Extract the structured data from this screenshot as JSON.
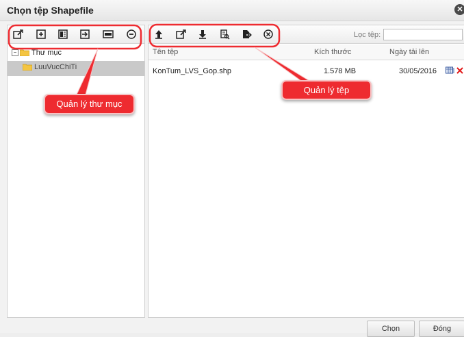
{
  "dialog": {
    "title": "Chọn tệp Shapefile"
  },
  "folder_pane": {
    "tree": {
      "root_label": "Thư mục",
      "child_label": "LuuVucChiTi"
    }
  },
  "file_pane": {
    "filter_label": "Lọc tệp:",
    "filter_value": "",
    "columns": {
      "name": "Tên tệp",
      "size": "Kích thước",
      "date": "Ngày tải lên"
    },
    "rows": [
      {
        "name": "KonTum_LVS_Gop.shp",
        "size": "1.578 MB",
        "date": "30/05/2016"
      }
    ]
  },
  "annotations": {
    "folder_management": "Quản lý thư mục",
    "file_management": "Quản lý tệp"
  },
  "footer": {
    "choose_label": "Chọn",
    "close_label": "Đóng"
  },
  "colors": {
    "callout": "#ee2b30",
    "folder": "#f4c542",
    "selected_row": "#c9c9c9"
  },
  "icons": [
    "folder-properties-icon",
    "new-folder-icon",
    "folder-list-icon",
    "move-folder-icon",
    "rename-folder-icon",
    "remove-folder-icon",
    "upload-icon",
    "file-properties-icon",
    "download-icon",
    "view-file-icon",
    "move-file-icon",
    "delete-file-icon"
  ]
}
